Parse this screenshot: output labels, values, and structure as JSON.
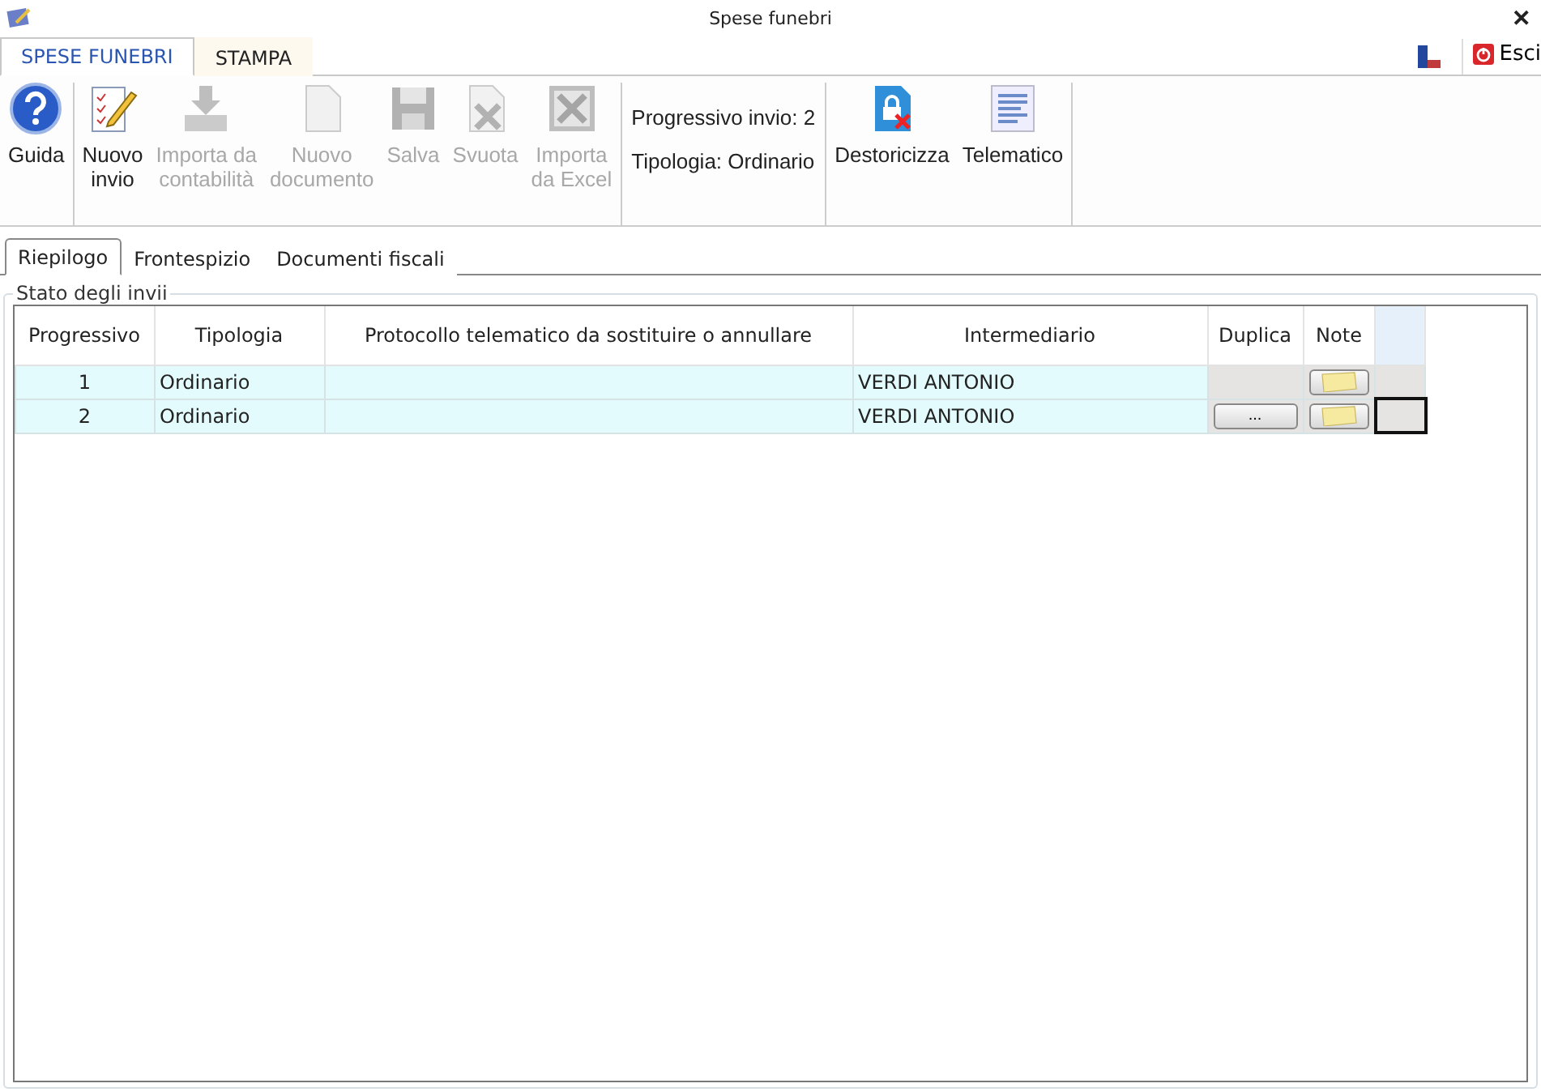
{
  "window": {
    "title": "Spese funebri",
    "close": "✕"
  },
  "ribbon_tabs": [
    {
      "label": "SPESE FUNEBRI",
      "selected": true
    },
    {
      "label": "STAMPA",
      "selected": false
    }
  ],
  "exit_button": "Esci",
  "toolbar_groups": [
    [
      {
        "label": "Guida",
        "disabled": false
      }
    ],
    [
      {
        "label": "Nuovo\ninvio",
        "disabled": false
      },
      {
        "label": "Importa da\ncontabilità",
        "disabled": true
      },
      {
        "label": "Nuovo\ndocumento",
        "disabled": true
      },
      {
        "label": "Salva",
        "disabled": true
      },
      {
        "label": "Svuota",
        "disabled": true
      },
      {
        "label": "Importa\nda Excel",
        "disabled": true
      }
    ]
  ],
  "info": [
    "Progressivo invio: 2",
    "Tipologia: Ordinario"
  ],
  "toolbar_groups_2": [
    [
      {
        "label": "Destoricizza",
        "disabled": false
      },
      {
        "label": "Telematico",
        "disabled": false
      }
    ]
  ],
  "sub_tabs": [
    {
      "label": "Riepilogo",
      "selected": true
    },
    {
      "label": "Frontespizio",
      "selected": false
    },
    {
      "label": "Documenti fiscali",
      "selected": false
    }
  ],
  "group_title": "Stato degli invii",
  "table": {
    "columns": [
      "Progressivo",
      "Tipologia",
      "Protocollo telematico da sostituire o annullare",
      "Intermediario",
      "Duplica",
      "Note"
    ],
    "rows": [
      {
        "progressivo": "1",
        "tipologia": "Ordinario",
        "intermediario": "VERDI ANTONIO",
        "focused": false
      },
      {
        "progressivo": "2",
        "tipologia": "Ordinario",
        "intermediario": "VERDI ANTONIO",
        "duplica": "...",
        "focused": true
      }
    ]
  }
}
